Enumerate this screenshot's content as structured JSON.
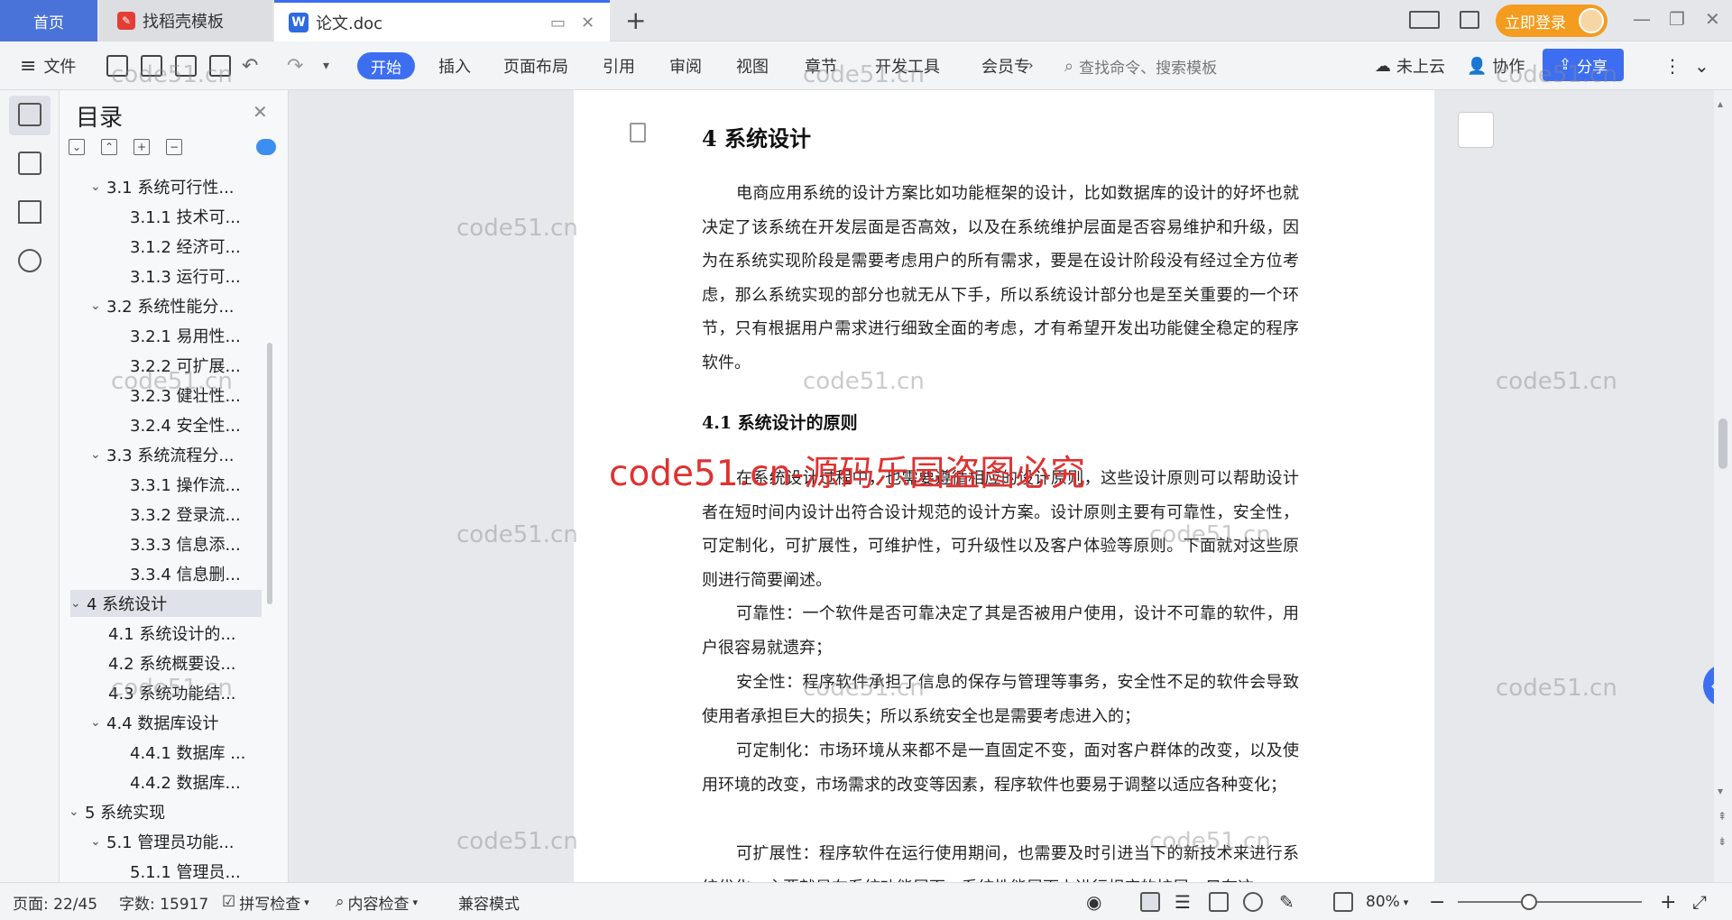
{
  "tabs": {
    "home": "首页",
    "template": "找稻壳模板",
    "document": "论文.doc"
  },
  "titlebar": {
    "login_label": "立即登录"
  },
  "toolbar": {
    "file_label": "文件",
    "start_label": "开始",
    "menu": [
      "插入",
      "页面布局",
      "引用",
      "审阅",
      "视图",
      "章节",
      "开发工具",
      "会员专"
    ],
    "search_placeholder": "查找命令、搜索模板",
    "cloud_label": "未上云",
    "collab_label": "协作",
    "share_label": "分享"
  },
  "toc": {
    "title": "目录",
    "items": [
      {
        "label": "3.1  系统可行性...",
        "level": 2,
        "chevron": true
      },
      {
        "label": "3.1.1  技术可...",
        "level": 3,
        "chevron": false
      },
      {
        "label": "3.1.2  经济可...",
        "level": 3,
        "chevron": false
      },
      {
        "label": "3.1.3  运行可...",
        "level": 3,
        "chevron": false
      },
      {
        "label": "3.2  系统性能分...",
        "level": 2,
        "chevron": true
      },
      {
        "label": "3.2.1  易用性...",
        "level": 3,
        "chevron": false
      },
      {
        "label": "3.2.2  可扩展...",
        "level": 3,
        "chevron": false
      },
      {
        "label": "3.2.3  健壮性...",
        "level": 3,
        "chevron": false
      },
      {
        "label": "3.2.4  安全性...",
        "level": 3,
        "chevron": false
      },
      {
        "label": "3.3  系统流程分...",
        "level": 2,
        "chevron": true
      },
      {
        "label": "3.3.1  操作流...",
        "level": 3,
        "chevron": false
      },
      {
        "label": "3.3.2  登录流...",
        "level": 3,
        "chevron": false
      },
      {
        "label": "3.3.3  信息添...",
        "level": 3,
        "chevron": false
      },
      {
        "label": "3.3.4  信息删...",
        "level": 3,
        "chevron": false
      },
      {
        "label": "4  系统设计",
        "level": 1,
        "chevron": true,
        "active": true
      },
      {
        "label": "4.1  系统设计的...",
        "level": 2,
        "chevron": false
      },
      {
        "label": "4.2  系统概要设...",
        "level": 2,
        "chevron": false
      },
      {
        "label": "4.3  系统功能结...",
        "level": 2,
        "chevron": false
      },
      {
        "label": "4.4  数据库设计",
        "level": 2,
        "chevron": true
      },
      {
        "label": "4.4.1  数据库 ...",
        "level": 3,
        "chevron": false
      },
      {
        "label": "4.4.2  数据库...",
        "level": 3,
        "chevron": false
      },
      {
        "label": "5  系统实现",
        "level": 1,
        "chevron": true
      },
      {
        "label": "5.1  管理员功能...",
        "level": 2,
        "chevron": true
      },
      {
        "label": "5.1.1  管理员...",
        "level": 3,
        "chevron": false
      }
    ]
  },
  "document": {
    "heading": "4  系统设计",
    "para1": "电商应用系统的设计方案比如功能框架的设计，比如数据库的设计的好坏也就决定了该系统在开发层面是否高效，以及在系统维护层面是否容易维护和升级，因为在系统实现阶段是需要考虑用户的所有需求，要是在设计阶段没有经过全方位考虑，那么系统实现的部分也就无从下手，所以系统设计部分也是至关重要的一个环节，只有根据用户需求进行细致全面的考虑，才有希望开发出功能健全稳定的程序软件。",
    "subheading": "4.1  系统设计的原则",
    "para2": "在系统设计过程中，也需要遵循相应的设计原则，这些设计原则可以帮助设计者在短时间内设计出符合设计规范的设计方案。设计原则主要有可靠性，安全性，可定制化，可扩展性，可维护性，可升级性以及客户体验等原则。下面就对这些原则进行简要阐述。",
    "para3": "可靠性：一个软件是否可靠决定了其是否被用户使用，设计不可靠的软件，用户很容易就遗弃；",
    "para4": "安全性：程序软件承担了信息的保存与管理等事务，安全性不足的软件会导致使用者承担巨大的损失；所以系统安全也是需要考虑进入的；",
    "para5": "可定制化：市场环境从来都不是一直固定不变，面对客户群体的改变，以及使用环境的改变，市场需求的改变等因素，程序软件也要易于调整以适应各种变化；",
    "para6": "可扩展性：程序软件在运行使用期间，也需要及时引进当下的新技术来进行系统优化，主要就是在系统功能层面，系统性能层面上进行相应的扩展，只有这"
  },
  "watermarks": {
    "text": "code51.cn",
    "banner": "code51.cn-源码乐园盗图必究"
  },
  "statusbar": {
    "page": "页面: 22/45",
    "words": "字数: 15917",
    "spellcheck": "拼写检查",
    "content_check": "内容检查",
    "compat_mode": "兼容模式",
    "zoom": "80%"
  },
  "colors": {
    "accent": "#3d6ef2",
    "home_tab": "#4a73d9",
    "login": "#f39c1f",
    "watermark_red": "#e03131"
  }
}
